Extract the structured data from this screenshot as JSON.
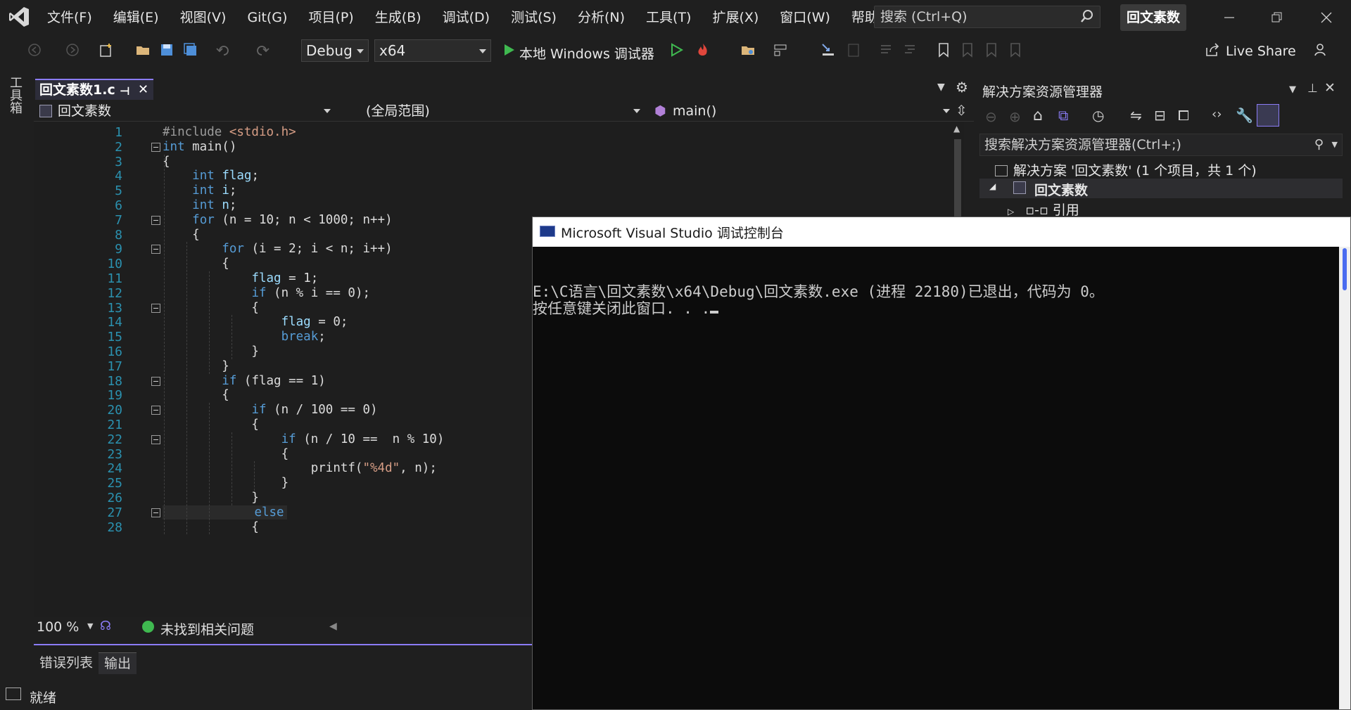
{
  "menu": [
    "文件(F)",
    "编辑(E)",
    "视图(V)",
    "Git(G)",
    "项目(P)",
    "生成(B)",
    "调试(D)",
    "测试(S)",
    "分析(N)",
    "工具(T)",
    "扩展(X)",
    "窗口(W)",
    "帮助(H)"
  ],
  "search": {
    "label": "搜索 (Ctrl+Q)"
  },
  "solution_name": "回文素数",
  "toolbar": {
    "config": "Debug",
    "platform": "x64",
    "run_label": "本地 Windows 调试器",
    "live_share": "Live Share"
  },
  "toolbox_label": "工具箱",
  "editor": {
    "tab_title": "回文素数1.c",
    "nav_project": "回文素数",
    "nav_scope": "(全局范围)",
    "nav_function": "main()",
    "zoom": "100 %",
    "issues": "未找到相关问题",
    "lines": [
      {
        "n": "1",
        "segs": [
          {
            "t": "#include ",
            "c": "pp"
          },
          {
            "t": "<stdio.h>",
            "c": "str"
          }
        ]
      },
      {
        "n": "2",
        "segs": [
          {
            "t": "int",
            "c": "kw"
          },
          {
            "t": " main()",
            "c": ""
          }
        ]
      },
      {
        "n": "3",
        "segs": [
          {
            "t": "{",
            "c": ""
          }
        ]
      },
      {
        "n": "4",
        "segs": [
          {
            "t": "    ",
            "c": ""
          },
          {
            "t": "int",
            "c": "kw"
          },
          {
            "t": " ",
            "c": ""
          },
          {
            "t": "flag",
            "c": "id"
          },
          {
            "t": ";",
            "c": ""
          }
        ]
      },
      {
        "n": "5",
        "segs": [
          {
            "t": "    ",
            "c": ""
          },
          {
            "t": "int",
            "c": "kw"
          },
          {
            "t": " ",
            "c": ""
          },
          {
            "t": "i",
            "c": "id"
          },
          {
            "t": ";",
            "c": ""
          }
        ]
      },
      {
        "n": "6",
        "segs": [
          {
            "t": "    ",
            "c": ""
          },
          {
            "t": "int",
            "c": "kw"
          },
          {
            "t": " ",
            "c": ""
          },
          {
            "t": "n",
            "c": "id"
          },
          {
            "t": ";",
            "c": ""
          }
        ]
      },
      {
        "n": "7",
        "segs": [
          {
            "t": "    ",
            "c": ""
          },
          {
            "t": "for",
            "c": "kw"
          },
          {
            "t": " (n = 10; n < 1000; n++)",
            "c": ""
          }
        ]
      },
      {
        "n": "8",
        "segs": [
          {
            "t": "    {",
            "c": ""
          }
        ]
      },
      {
        "n": "9",
        "segs": [
          {
            "t": "        ",
            "c": ""
          },
          {
            "t": "for",
            "c": "kw"
          },
          {
            "t": " (i = 2; i < n; i++)",
            "c": ""
          }
        ]
      },
      {
        "n": "10",
        "segs": [
          {
            "t": "        {",
            "c": ""
          }
        ]
      },
      {
        "n": "11",
        "segs": [
          {
            "t": "            ",
            "c": ""
          },
          {
            "t": "flag",
            "c": "id"
          },
          {
            "t": " = 1;",
            "c": ""
          }
        ]
      },
      {
        "n": "12",
        "segs": [
          {
            "t": "            ",
            "c": ""
          },
          {
            "t": "if",
            "c": "kw"
          },
          {
            "t": " (n % i == 0);",
            "c": ""
          }
        ]
      },
      {
        "n": "13",
        "segs": [
          {
            "t": "            {",
            "c": ""
          }
        ]
      },
      {
        "n": "14",
        "segs": [
          {
            "t": "                ",
            "c": ""
          },
          {
            "t": "flag",
            "c": "id"
          },
          {
            "t": " = 0;",
            "c": ""
          }
        ]
      },
      {
        "n": "15",
        "segs": [
          {
            "t": "                ",
            "c": ""
          },
          {
            "t": "break",
            "c": "kw"
          },
          {
            "t": ";",
            "c": ""
          }
        ]
      },
      {
        "n": "16",
        "segs": [
          {
            "t": "            }",
            "c": ""
          }
        ]
      },
      {
        "n": "17",
        "segs": [
          {
            "t": "        }",
            "c": ""
          }
        ]
      },
      {
        "n": "18",
        "segs": [
          {
            "t": "        ",
            "c": ""
          },
          {
            "t": "if",
            "c": "kw"
          },
          {
            "t": " (flag == 1)",
            "c": ""
          }
        ]
      },
      {
        "n": "19",
        "segs": [
          {
            "t": "        {",
            "c": ""
          }
        ]
      },
      {
        "n": "20",
        "segs": [
          {
            "t": "            ",
            "c": ""
          },
          {
            "t": "if",
            "c": "kw"
          },
          {
            "t": " (n / 100 == 0)",
            "c": ""
          }
        ]
      },
      {
        "n": "21",
        "segs": [
          {
            "t": "            {",
            "c": ""
          }
        ]
      },
      {
        "n": "22",
        "segs": [
          {
            "t": "                ",
            "c": ""
          },
          {
            "t": "if",
            "c": "kw"
          },
          {
            "t": " (n / 10 ==  n % 10)",
            "c": ""
          }
        ]
      },
      {
        "n": "23",
        "segs": [
          {
            "t": "                {",
            "c": ""
          }
        ]
      },
      {
        "n": "24",
        "segs": [
          {
            "t": "                    printf(",
            "c": ""
          },
          {
            "t": "\"%4d\"",
            "c": "str"
          },
          {
            "t": ", n);",
            "c": ""
          }
        ]
      },
      {
        "n": "25",
        "segs": [
          {
            "t": "                }",
            "c": ""
          }
        ]
      },
      {
        "n": "26",
        "segs": [
          {
            "t": "            }",
            "c": ""
          }
        ]
      },
      {
        "n": "27",
        "segs": [
          {
            "t": "            ",
            "c": ""
          },
          {
            "t": "else",
            "c": "kw"
          }
        ]
      },
      {
        "n": "28",
        "segs": [
          {
            "t": "            {",
            "c": ""
          }
        ]
      }
    ]
  },
  "bottom_tabs": [
    "错误列表",
    "输出"
  ],
  "status": "就绪",
  "solution_explorer": {
    "title": "解决方案资源管理器",
    "search": "搜索解决方案资源管理器(Ctrl+;)",
    "solution_row": "解决方案 '回文素数' (1 个项目，共 1 个)",
    "project_row": "回文素数",
    "ref_row": "引用"
  },
  "console": {
    "title": "Microsoft Visual Studio 调试控制台",
    "line1": "E:\\C语言\\回文素数\\x64\\Debug\\回文素数.exe (进程 22180)已退出，代码为 0。",
    "line2": "按任意键关闭此窗口. . ."
  },
  "colors": {
    "accent": "#8b7cf6",
    "keyword": "#569cd6",
    "line_number": "#2b91af",
    "run_green": "#3fb950"
  }
}
